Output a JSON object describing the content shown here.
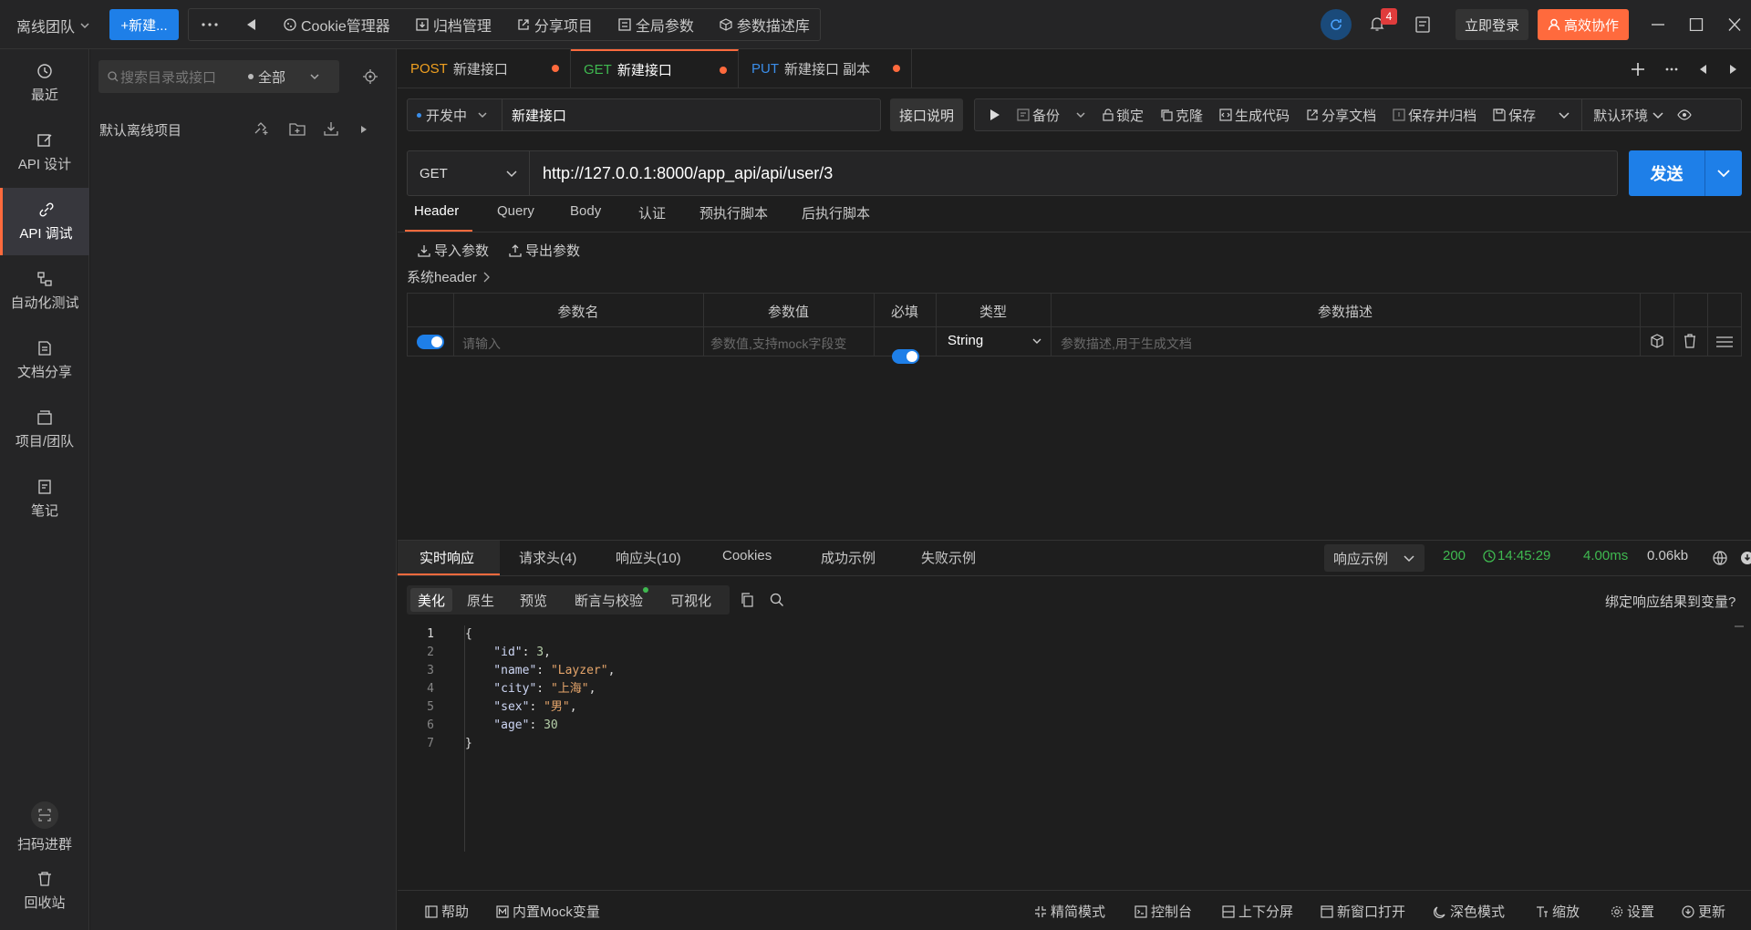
{
  "topbar": {
    "team": "离线团队",
    "new_button": "+新建...",
    "items": [
      "Cookie管理器",
      "归档管理",
      "分享项目",
      "全局参数",
      "参数描述库"
    ],
    "notification_count": "4",
    "login": "立即登录",
    "collab": "高效协作"
  },
  "leftnav": {
    "items": [
      "最近",
      "API 设计",
      "API 调试",
      "自动化测试",
      "文档分享",
      "项目/团队",
      "笔记"
    ],
    "bottom": [
      "扫码进群",
      "回收站"
    ]
  },
  "tree": {
    "search_placeholder": "搜索目录或接口",
    "filter": "全部",
    "project": "默认离线项目"
  },
  "tabs": [
    {
      "method": "POST",
      "name": "新建接口",
      "color": "#f0a020"
    },
    {
      "method": "GET",
      "name": "新建接口",
      "color": "#3fb950"
    },
    {
      "method": "PUT",
      "name": "新建接口 副本",
      "color": "#3b8eea"
    }
  ],
  "request": {
    "status": "开发中",
    "name": "新建接口",
    "desc_button": "接口说明",
    "actions": [
      "备份",
      "锁定",
      "克隆",
      "生成代码",
      "分享文档",
      "保存并归档",
      "保存"
    ],
    "env": "默认环境",
    "method": "GET",
    "url": "http://127.0.0.1:8000/app_api/api/user/3",
    "send": "发送"
  },
  "req_tabs": [
    "Header",
    "Query",
    "Body",
    "认证",
    "预执行脚本",
    "后执行脚本"
  ],
  "header_panel": {
    "import": "导入参数",
    "export": "导出参数",
    "system_header": "系统header",
    "columns": [
      "参数名",
      "参数值",
      "必填",
      "类型",
      "参数描述"
    ],
    "row": {
      "name_placeholder": "请输入",
      "value_placeholder": "参数值,支持mock字段变",
      "type": "String",
      "desc_placeholder": "参数描述,用于生成文档"
    }
  },
  "resp_tabs": [
    "实时响应",
    "请求头(4)",
    "响应头(10)",
    "Cookies",
    "成功示例",
    "失败示例"
  ],
  "resp_info": {
    "example": "响应示例",
    "status": "200",
    "time": "14:45:29",
    "duration": "4.00ms",
    "size": "0.06kb"
  },
  "view_tabs": [
    "美化",
    "原生",
    "预览",
    "断言与校验",
    "可视化"
  ],
  "bind_text": "绑定响应结果到变量?",
  "code_lines": [
    "{",
    "    \"id\": 3,",
    "    \"name\": \"Layzer\",",
    "    \"city\": \"上海\",",
    "    \"sex\": \"男\",",
    "    \"age\": 30",
    "}"
  ],
  "bottom_bar": [
    "帮助",
    "内置Mock变量",
    "精简模式",
    "控制台",
    "上下分屏",
    "新窗口打开",
    "深色模式",
    "缩放",
    "设置",
    "更新"
  ]
}
